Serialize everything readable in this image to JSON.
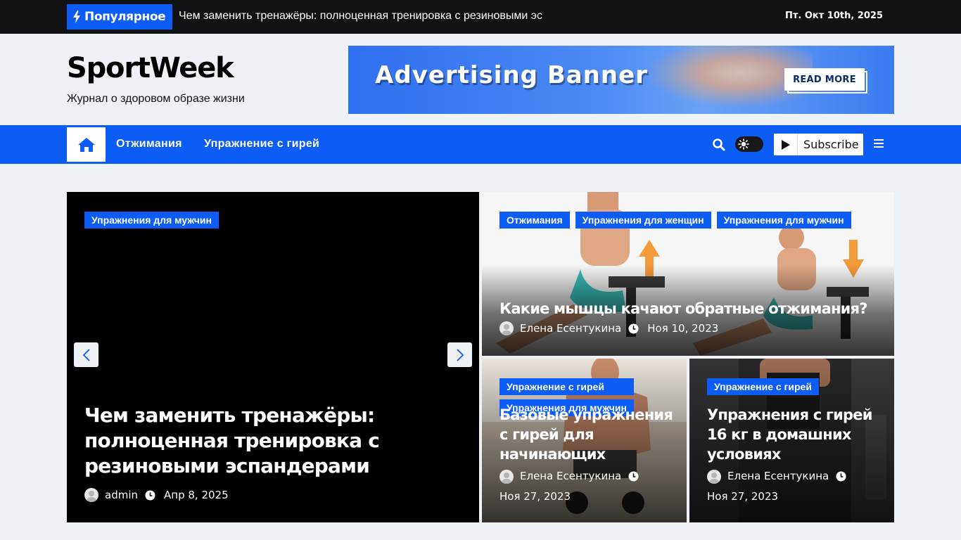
{
  "topbar": {
    "popular_label": "Популярное",
    "ticker_text": "Чем заменить тренажёры: полноценная тренировка с резиновыми эспандерами",
    "date": "Пт. Окт 10th, 2025"
  },
  "header": {
    "site_title": "SportWeek",
    "tagline": "Журнал о здоровом образе жизни",
    "ad_title": "Advertising Banner",
    "ad_button": "READ MORE"
  },
  "nav": {
    "items": [
      {
        "label": "Отжимания"
      },
      {
        "label": "Упражнение с гирей"
      }
    ],
    "subscribe_label": "Subscribe",
    "colors": {
      "accent": "#0d5cf5",
      "topbar": "#111214"
    }
  },
  "slider": {
    "category": "Упражнения для мужчин",
    "title": "Чем заменить тренажёры: полноценная тренировка с резиновыми эспандерами",
    "author": "admin",
    "date": "Апр 8, 2025"
  },
  "featured": [
    {
      "categories": [
        "Отжимания",
        "Упражнения для женщин",
        "Упражнения для мужчин"
      ],
      "title": "Какие мышцы качают обратные отжимания?",
      "author": "Елена Есентукина",
      "date": "Ноя 10, 2023"
    },
    {
      "categories": [
        "Упражнение с гирей",
        "Упражнения для мужчин"
      ],
      "title": "Базовые упражнения с гирей для начинающих",
      "author": "Елена Есентукина",
      "date": "Ноя 27, 2023"
    },
    {
      "categories": [
        "Упражнение с гирей"
      ],
      "title": "Упражнения с гирей 16 кг в домашних условиях",
      "author": "Елена Есентукина",
      "date": "Ноя 27, 2023"
    }
  ]
}
